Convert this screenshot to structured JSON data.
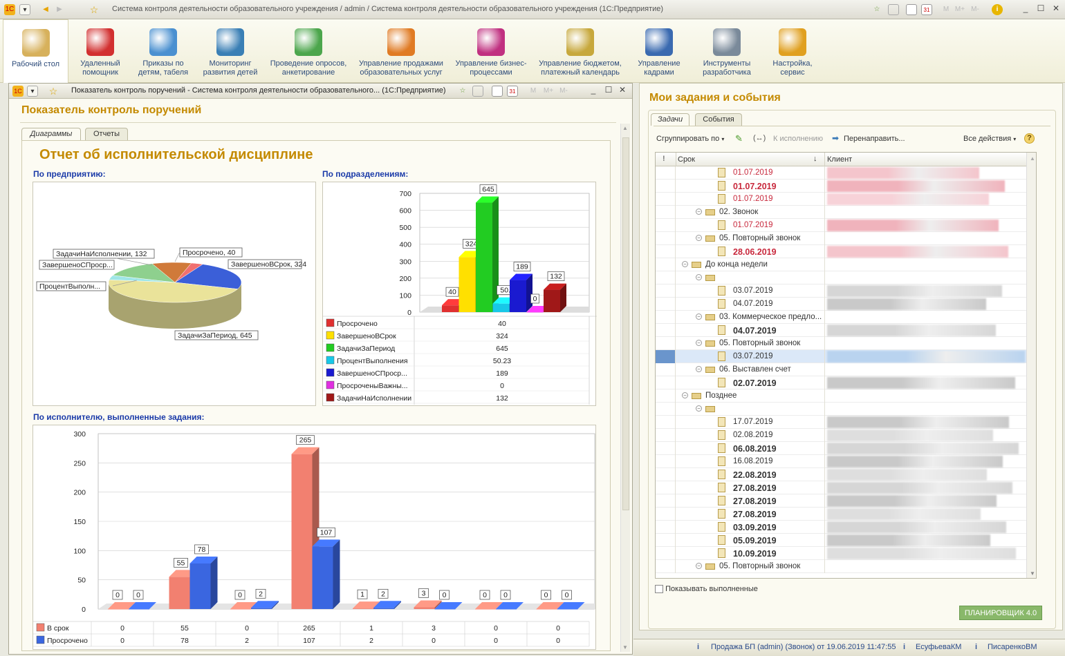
{
  "app": {
    "title": "Система контроля деятельности образовательного учреждения / admin / Система контроля деятельности образовательного учреждения   (1С:Предприятие)"
  },
  "ribbon": [
    {
      "label": "Рабочий стол",
      "icon": "desk-icon",
      "color": "#d7b15c"
    },
    {
      "label": "Удаленный помощник",
      "icon": "remote-icon",
      "color": "#d23030"
    },
    {
      "label": "Приказы по детям, табеля",
      "icon": "orders-icon",
      "color": "#4a90d0"
    },
    {
      "label": "Мониторинг развития детей",
      "icon": "globe-icon",
      "color": "#3a7fb5"
    },
    {
      "label": "Проведение опросов, анкетирование",
      "icon": "check-icon",
      "color": "#4ca64c"
    },
    {
      "label": "Управление продажами образовательных услуг",
      "icon": "crm-icon",
      "color": "#e07b24"
    },
    {
      "label": "Управление бизнес-процессами",
      "icon": "cube-icon",
      "color": "#c03080"
    },
    {
      "label": "Управление бюджетом, платежный календарь",
      "icon": "money-icon",
      "color": "#c7a83c"
    },
    {
      "label": "Управление кадрами",
      "icon": "person-icon",
      "color": "#3a6ab0"
    },
    {
      "label": "Инструменты разработчика",
      "icon": "tools-icon",
      "color": "#7a8a9a"
    },
    {
      "label": "Настройка, сервис",
      "icon": "toolbox-icon",
      "color": "#e0a020"
    }
  ],
  "report_window": {
    "title": "Показатель контроль поручений - Система контроля деятельности образовательного... (1С:Предприятие)",
    "heading": "Показатель контроль поручений",
    "tabs": [
      "Диаграммы",
      "Отчеты"
    ],
    "report_title": "Отчет об исполнительской дисциплине",
    "sec_enterprise": "По предприятию:",
    "sec_departments": "По подразделениям:",
    "sec_executors": "По исполнителю, выполненные задания:"
  },
  "chart_data": [
    {
      "type": "pie",
      "slices": [
        {
          "label": "Просрочено",
          "value": 40,
          "color": "#f07070"
        },
        {
          "label": "ЗавершеноВСрок",
          "value": 324,
          "color": "#3b5fd8"
        },
        {
          "label": "ЗадачиЗаПериод",
          "value": 645,
          "color": "#eae39a"
        },
        {
          "label": "ПроцентВыполн...",
          "value": 50.23,
          "color": "#9fe6e6"
        },
        {
          "label": "ЗавершеноСПроср...",
          "value": 189,
          "color": "#8ed08e"
        },
        {
          "label": "ЗадачиНаИсполнении",
          "value": 132,
          "color": "#d07a3a"
        }
      ],
      "annotations": [
        "ЗадачиНаИсполнении, 132",
        "Просрочено, 40",
        "ЗавершеноСПроср...",
        "ЗавершеноВСрок, 324",
        "ПроцентВыполн...",
        "ЗадачиЗаПериод, 645"
      ]
    },
    {
      "type": "bar",
      "ylim": [
        0,
        700
      ],
      "yticks": [
        0,
        100,
        200,
        300,
        400,
        500,
        600,
        700
      ],
      "series": [
        {
          "name": "Просрочено",
          "value": 40,
          "label": "40",
          "color": "#e03030"
        },
        {
          "name": "ЗавершеноВСрок",
          "value": 324,
          "label": "324",
          "color": "#ffe000"
        },
        {
          "name": "ЗадачиЗаПериод",
          "value": 645,
          "label": "645",
          "color": "#22cc22"
        },
        {
          "name": "ПроцентВыполнения",
          "value": 50.23,
          "label": "50.23",
          "color": "#18c8e8"
        },
        {
          "name": "ЗавершеноСПроср...",
          "value": 189,
          "label": "189",
          "color": "#1a1ad0"
        },
        {
          "name": "ПросроченыВажны...",
          "value": 0,
          "label": "0",
          "color": "#e030e0"
        },
        {
          "name": "ЗадачиНаИсполнении",
          "value": 132,
          "label": "132",
          "color": "#a01818"
        }
      ]
    },
    {
      "type": "bar",
      "ylim": [
        0,
        300
      ],
      "yticks": [
        0,
        50,
        100,
        150,
        200,
        250,
        300
      ],
      "categories": [
        "",
        "",
        "",
        "",
        "",
        "",
        "",
        ""
      ],
      "series": [
        {
          "name": "В срок",
          "values": [
            0,
            55,
            0,
            265,
            1,
            3,
            0,
            0
          ],
          "color": "#f28070"
        },
        {
          "name": "Просрочено",
          "values": [
            0,
            78,
            2,
            107,
            2,
            0,
            0,
            0
          ],
          "color": "#3a66e0"
        }
      ]
    }
  ],
  "tasks_panel": {
    "title": "Мои задания и события",
    "tabs": [
      "Задачи",
      "События"
    ],
    "toolbar": {
      "group": "Сгруппировать по",
      "execute": "К исполнению",
      "redirect": "Перенаправить...",
      "all_actions": "Все действия"
    },
    "columns": {
      "deadline": "Срок",
      "client": "Клиент"
    },
    "rows": [
      {
        "text": "01.07.2019",
        "kind": "date",
        "red": true,
        "bold": false,
        "indent": 3
      },
      {
        "text": "01.07.2019",
        "kind": "date",
        "red": true,
        "bold": true,
        "indent": 3
      },
      {
        "text": "01.07.2019",
        "kind": "date",
        "red": true,
        "bold": false,
        "indent": 3
      },
      {
        "text": "02. Звонок",
        "kind": "group",
        "indent": 2
      },
      {
        "text": "01.07.2019",
        "kind": "date",
        "red": true,
        "bold": false,
        "indent": 3
      },
      {
        "text": "05. Повторный звонок",
        "kind": "group",
        "indent": 2
      },
      {
        "text": "28.06.2019",
        "kind": "date",
        "red": true,
        "bold": true,
        "indent": 3
      },
      {
        "text": "До конца недели",
        "kind": "group",
        "indent": 1
      },
      {
        "text": "",
        "kind": "group",
        "indent": 2
      },
      {
        "text": "03.07.2019",
        "kind": "date",
        "red": false,
        "bold": false,
        "indent": 3
      },
      {
        "text": "04.07.2019",
        "kind": "date",
        "red": false,
        "bold": false,
        "indent": 3
      },
      {
        "text": "03. Коммерческое предло...",
        "kind": "group",
        "indent": 2
      },
      {
        "text": "04.07.2019",
        "kind": "date",
        "red": false,
        "bold": true,
        "indent": 3
      },
      {
        "text": "05. Повторный звонок",
        "kind": "group",
        "indent": 2
      },
      {
        "text": "03.07.2019",
        "kind": "date",
        "red": false,
        "bold": false,
        "indent": 3,
        "selected": true
      },
      {
        "text": "06. Выставлен счет",
        "kind": "group",
        "indent": 2
      },
      {
        "text": "02.07.2019",
        "kind": "date",
        "red": false,
        "bold": true,
        "indent": 3
      },
      {
        "text": "Позднее",
        "kind": "group",
        "indent": 1
      },
      {
        "text": "",
        "kind": "group",
        "indent": 2
      },
      {
        "text": "17.07.2019",
        "kind": "date",
        "red": false,
        "bold": false,
        "indent": 3
      },
      {
        "text": "02.08.2019",
        "kind": "date",
        "red": false,
        "bold": false,
        "indent": 3
      },
      {
        "text": "06.08.2019",
        "kind": "date",
        "red": false,
        "bold": true,
        "indent": 3
      },
      {
        "text": "16.08.2019",
        "kind": "date",
        "red": false,
        "bold": false,
        "indent": 3
      },
      {
        "text": "22.08.2019",
        "kind": "date",
        "red": false,
        "bold": true,
        "indent": 3
      },
      {
        "text": "27.08.2019",
        "kind": "date",
        "red": false,
        "bold": true,
        "indent": 3
      },
      {
        "text": "27.08.2019",
        "kind": "date",
        "red": false,
        "bold": true,
        "indent": 3
      },
      {
        "text": "27.08.2019",
        "kind": "date",
        "red": false,
        "bold": true,
        "indent": 3
      },
      {
        "text": "03.09.2019",
        "kind": "date",
        "red": false,
        "bold": true,
        "indent": 3
      },
      {
        "text": "05.09.2019",
        "kind": "date",
        "red": false,
        "bold": true,
        "indent": 3
      },
      {
        "text": "10.09.2019",
        "kind": "date",
        "red": false,
        "bold": true,
        "indent": 3
      },
      {
        "text": "05. Повторный звонок",
        "kind": "group",
        "indent": 2
      }
    ],
    "show_done": "Показывать выполненные",
    "planner_button": "ПЛАНИРОВЩИК 4.0"
  },
  "status": {
    "item1": "Продажа БП (admin) (Звонок) от 19.06.2019 11:47:55",
    "item2": "ЕсуфьеваКМ",
    "item3": "ПисаренкоВМ"
  }
}
